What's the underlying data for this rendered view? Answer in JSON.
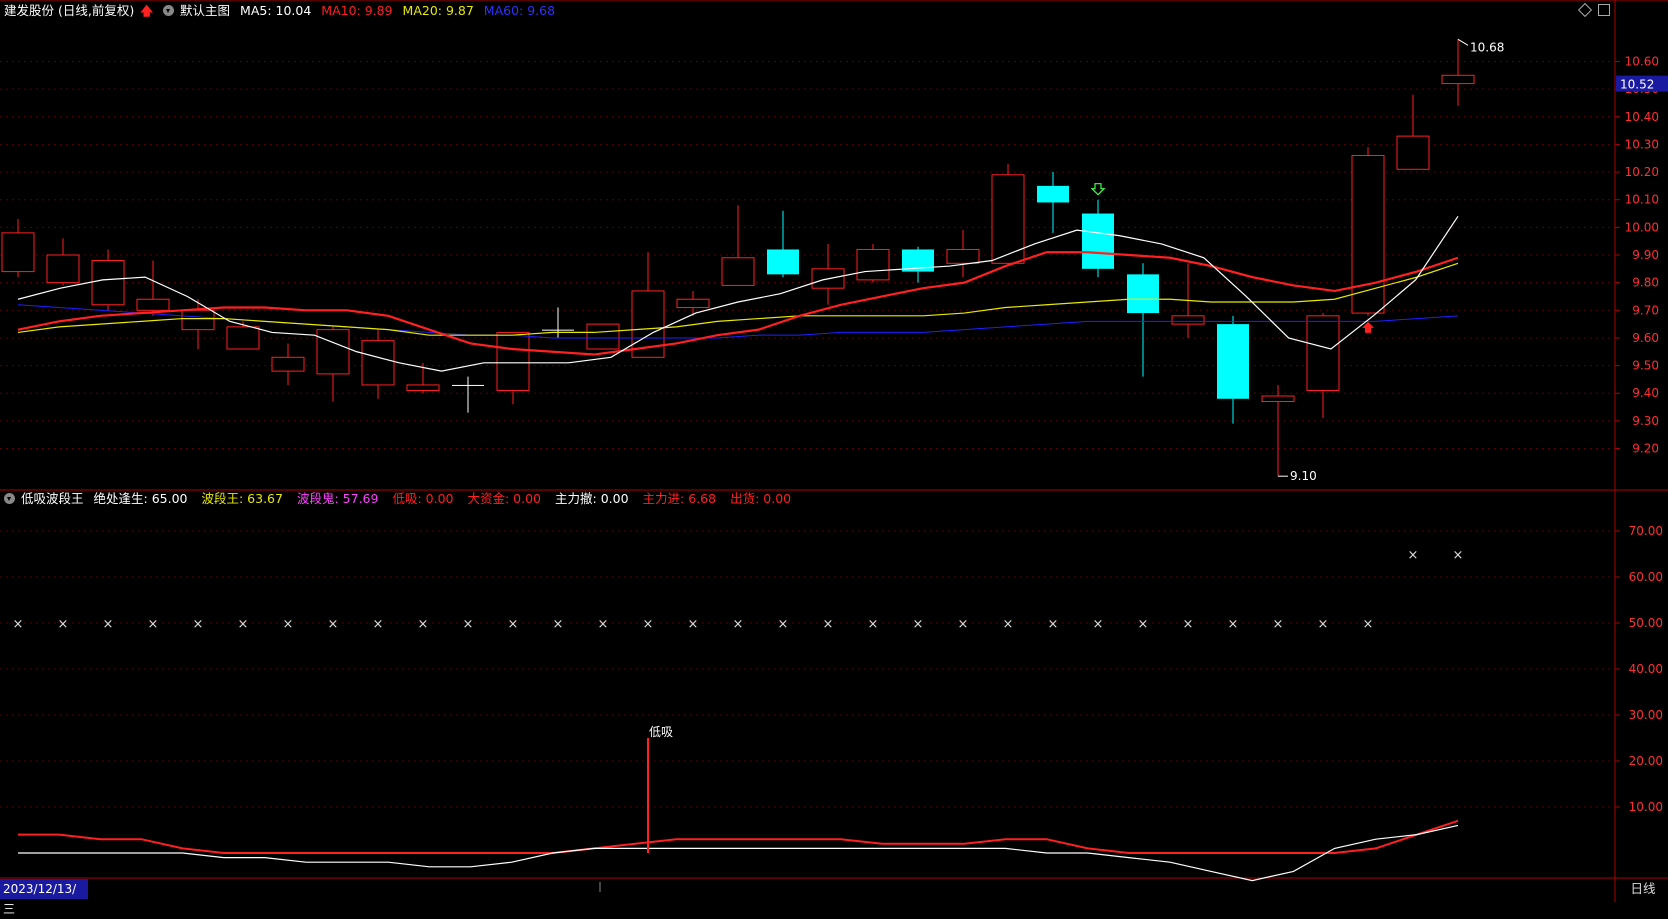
{
  "header": {
    "stock": "建发股份 (日线,前复权)",
    "main_chart_label": "默认主图",
    "ma5": "MA5: 10.04",
    "ma10": "MA10: 9.89",
    "ma20": "MA20: 9.87",
    "ma60": "MA60: 9.68"
  },
  "indicator_header": {
    "name": "低吸波段王",
    "items": [
      {
        "label": "绝处逢生:",
        "value": "65.00",
        "color": "#ffffff"
      },
      {
        "label": "波段王:",
        "value": "63.67",
        "color": "#e8e800"
      },
      {
        "label": "波段鬼:",
        "value": "57.69",
        "color": "#ff40ff"
      },
      {
        "label": "低吸:",
        "value": "0.00",
        "color": "#ff2020"
      },
      {
        "label": "大资金:",
        "value": "0.00",
        "color": "#ff2020"
      },
      {
        "label": "主力撤:",
        "value": "0.00",
        "color": "#ffffff"
      },
      {
        "label": "主力进:",
        "value": "6.68",
        "color": "#ff2020"
      },
      {
        "label": "出货:",
        "value": "0.00",
        "color": "#ff2020"
      }
    ]
  },
  "footer": {
    "date": "2023/12/13/三",
    "period": "日线"
  },
  "colors": {
    "up": "#ff2020",
    "down": "#00ffff",
    "ma5": "#ffffff",
    "ma10": "#ff2020",
    "ma20": "#e8e800",
    "ma60": "#2020ff",
    "axis": "#b00000"
  },
  "chart_data": [
    {
      "type": "candlestick",
      "title": "建发股份 (日线,前复权)",
      "ylim": [
        9.05,
        10.75
      ],
      "y_ticks": [
        "10.60",
        "10.50",
        "10.40",
        "10.30",
        "10.20",
        "10.10",
        "10.00",
        "9.90",
        "9.80",
        "9.70",
        "9.60",
        "9.50",
        "9.40",
        "9.30",
        "9.20"
      ],
      "last_price_label": "10.52",
      "high_annotation": "10.68",
      "low_annotation": "9.10",
      "candles": [
        {
          "o": 9.84,
          "h": 10.03,
          "l": 9.82,
          "c": 9.98
        },
        {
          "o": 9.8,
          "h": 9.96,
          "l": 9.79,
          "c": 9.9
        },
        {
          "o": 9.72,
          "h": 9.92,
          "l": 9.7,
          "c": 9.88
        },
        {
          "o": 9.7,
          "h": 9.88,
          "l": 9.68,
          "c": 9.74
        },
        {
          "o": 9.63,
          "h": 9.74,
          "l": 9.56,
          "c": 9.7
        },
        {
          "o": 9.56,
          "h": 9.66,
          "l": 9.56,
          "c": 9.64
        },
        {
          "o": 9.48,
          "h": 9.58,
          "l": 9.43,
          "c": 9.53
        },
        {
          "o": 9.47,
          "h": 9.64,
          "l": 9.37,
          "c": 9.63
        },
        {
          "o": 9.43,
          "h": 9.63,
          "l": 9.38,
          "c": 9.59
        },
        {
          "o": 9.41,
          "h": 9.51,
          "l": 9.4,
          "c": 9.43
        },
        {
          "o": 9.43,
          "h": 9.46,
          "l": 9.33,
          "c": 9.43
        },
        {
          "o": 9.41,
          "h": 9.62,
          "l": 9.36,
          "c": 9.62
        },
        {
          "o": 9.63,
          "h": 9.71,
          "l": 9.6,
          "c": 9.63
        },
        {
          "o": 9.56,
          "h": 9.65,
          "l": 9.56,
          "c": 9.65
        },
        {
          "o": 9.53,
          "h": 9.91,
          "l": 9.53,
          "c": 9.77
        },
        {
          "o": 9.71,
          "h": 9.77,
          "l": 9.68,
          "c": 9.74
        },
        {
          "o": 9.79,
          "h": 10.08,
          "l": 9.79,
          "c": 9.89
        },
        {
          "o": 9.92,
          "h": 10.06,
          "l": 9.82,
          "c": 9.83
        },
        {
          "o": 9.78,
          "h": 9.94,
          "l": 9.72,
          "c": 9.85
        },
        {
          "o": 9.81,
          "h": 9.94,
          "l": 9.8,
          "c": 9.92
        },
        {
          "o": 9.92,
          "h": 9.93,
          "l": 9.8,
          "c": 9.84
        },
        {
          "o": 9.87,
          "h": 9.99,
          "l": 9.82,
          "c": 9.92
        },
        {
          "o": 9.87,
          "h": 10.23,
          "l": 9.86,
          "c": 10.19
        },
        {
          "o": 10.15,
          "h": 10.2,
          "l": 9.98,
          "c": 10.09
        },
        {
          "o": 10.05,
          "h": 10.1,
          "l": 9.82,
          "c": 9.85
        },
        {
          "o": 9.83,
          "h": 9.87,
          "l": 9.46,
          "c": 9.69
        },
        {
          "o": 9.65,
          "h": 9.87,
          "l": 9.6,
          "c": 9.68
        },
        {
          "o": 9.65,
          "h": 9.68,
          "l": 9.29,
          "c": 9.38
        },
        {
          "o": 9.37,
          "h": 9.43,
          "l": 9.1,
          "c": 9.39
        },
        {
          "o": 9.41,
          "h": 9.69,
          "l": 9.31,
          "c": 9.68
        },
        {
          "o": 9.69,
          "h": 10.29,
          "l": 9.68,
          "c": 10.26
        },
        {
          "o": 10.21,
          "h": 10.48,
          "l": 10.21,
          "c": 10.33
        },
        {
          "o": 10.52,
          "h": 10.68,
          "l": 10.44,
          "c": 10.55
        }
      ],
      "ma5": [
        9.74,
        9.78,
        9.81,
        9.82,
        9.75,
        9.66,
        9.62,
        9.61,
        9.55,
        9.51,
        9.48,
        9.51,
        9.51,
        9.51,
        9.53,
        9.62,
        9.69,
        9.73,
        9.76,
        9.81,
        9.84,
        9.85,
        9.86,
        9.88,
        9.94,
        9.99,
        9.97,
        9.94,
        9.89,
        9.75,
        9.6,
        9.56,
        9.68,
        9.81,
        10.04
      ],
      "ma10": [
        9.63,
        9.66,
        9.68,
        9.69,
        9.7,
        9.71,
        9.71,
        9.7,
        9.7,
        9.68,
        9.63,
        9.58,
        9.56,
        9.55,
        9.54,
        9.56,
        9.58,
        9.61,
        9.63,
        9.68,
        9.72,
        9.75,
        9.78,
        9.8,
        9.86,
        9.91,
        9.91,
        9.9,
        9.89,
        9.86,
        9.82,
        9.79,
        9.77,
        9.8,
        9.84,
        9.89
      ],
      "ma20": [
        9.62,
        9.64,
        9.65,
        9.66,
        9.67,
        9.67,
        9.66,
        9.65,
        9.64,
        9.63,
        9.61,
        9.61,
        9.61,
        9.62,
        9.62,
        9.63,
        9.64,
        9.66,
        9.67,
        9.68,
        9.68,
        9.68,
        9.68,
        9.69,
        9.71,
        9.72,
        9.73,
        9.74,
        9.74,
        9.73,
        9.73,
        9.73,
        9.74,
        9.78,
        9.82,
        9.87
      ],
      "ma60": [
        9.72,
        9.71,
        9.7,
        9.69,
        9.68,
        9.67,
        9.66,
        9.65,
        9.64,
        9.63,
        9.62,
        9.61,
        9.61,
        9.6,
        9.6,
        9.6,
        9.6,
        9.6,
        9.61,
        9.61,
        9.62,
        9.62,
        9.62,
        9.63,
        9.64,
        9.65,
        9.66,
        9.66,
        9.66,
        9.66,
        9.66,
        9.66,
        9.66,
        9.66,
        9.67,
        9.68
      ],
      "signals": [
        {
          "index": 24,
          "type": "sell-arrow",
          "color": "#40ff40"
        },
        {
          "index": 30,
          "type": "buy-arrow",
          "color": "#ff2020"
        }
      ]
    },
    {
      "type": "line",
      "title": "低吸波段王",
      "ylim": [
        0,
        80
      ],
      "y_ticks": [
        "70.00",
        "60.00",
        "50.00",
        "40.00",
        "30.00",
        "20.00",
        "10.00"
      ],
      "markers": {
        "symbol": "×",
        "y_first": 50,
        "y_last": 65,
        "switch_index": 31
      },
      "low_buy_spike": {
        "index": 14,
        "value": 25,
        "label": "低吸"
      },
      "series": [
        {
          "color": "#ff2020",
          "values": [
            4,
            4,
            3,
            3,
            1,
            0,
            0,
            0,
            0,
            0,
            0,
            0,
            0,
            0,
            1,
            2,
            3,
            3,
            3,
            3,
            3,
            2,
            2,
            2,
            3,
            3,
            1,
            0,
            0,
            0,
            0,
            0,
            0,
            1,
            4,
            7
          ]
        },
        {
          "color": "#ffffff",
          "values": [
            0,
            0,
            0,
            0,
            0,
            -1,
            -1,
            -2,
            -2,
            -2,
            -3,
            -3,
            -2,
            0,
            1,
            1,
            1,
            1,
            1,
            1,
            1,
            1,
            1,
            1,
            1,
            0,
            0,
            -1,
            -2,
            -4,
            -6,
            -4,
            1,
            3,
            4,
            6
          ]
        }
      ]
    }
  ]
}
